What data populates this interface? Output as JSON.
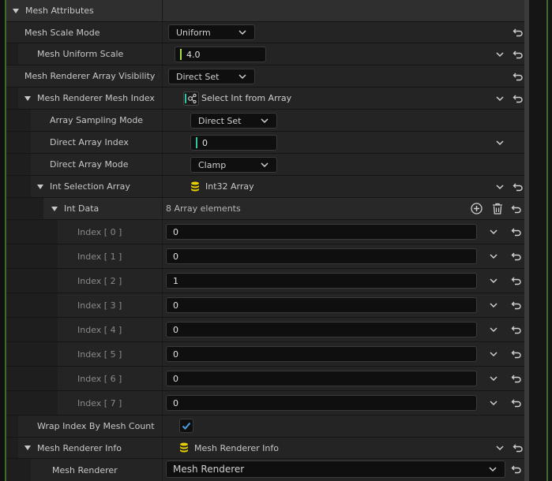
{
  "section": {
    "title": "Mesh Attributes"
  },
  "rows": {
    "scale_mode": {
      "label": "Mesh Scale Mode",
      "value": "Uniform"
    },
    "uniform_scale": {
      "label": "Mesh Uniform Scale",
      "value": "4.0"
    },
    "visibility_mode": {
      "label": "Mesh Renderer Array Visibility Mo",
      "value": "Direct Set"
    },
    "mesh_index": {
      "label": "Mesh Renderer Mesh Index",
      "value": "Select Int from Array"
    },
    "sampling_mode": {
      "label": "Array Sampling Mode",
      "value": "Direct Set"
    },
    "direct_index": {
      "label": "Direct Array Index",
      "value": "0"
    },
    "direct_mode": {
      "label": "Direct Array Mode",
      "value": "Clamp"
    },
    "int_selection": {
      "label": "Int Selection Array",
      "value": "Int32 Array"
    },
    "int_data": {
      "label": "Int Data",
      "value": "8 Array elements"
    },
    "wrap_index": {
      "label": "Wrap Index By Mesh Count",
      "checked": true
    },
    "renderer_info": {
      "label": "Mesh Renderer Info",
      "value": "Mesh Renderer Info"
    },
    "mesh_renderer": {
      "label": "Mesh Renderer",
      "value": "Mesh Renderer"
    }
  },
  "array": [
    {
      "label": "Index [ 0 ]",
      "value": "0"
    },
    {
      "label": "Index [ 1 ]",
      "value": "0"
    },
    {
      "label": "Index [ 2 ]",
      "value": "1"
    },
    {
      "label": "Index [ 3 ]",
      "value": "0"
    },
    {
      "label": "Index [ 4 ]",
      "value": "0"
    },
    {
      "label": "Index [ 5 ]",
      "value": "0"
    },
    {
      "label": "Index [ 6 ]",
      "value": "0"
    },
    {
      "label": "Index [ 7 ]",
      "value": "0"
    }
  ],
  "colors": {
    "float_bar": "#a8e24a",
    "int_bar": "#2ec7a6",
    "array_icon": "#e8d000",
    "checkbox": "#4a9de0"
  }
}
